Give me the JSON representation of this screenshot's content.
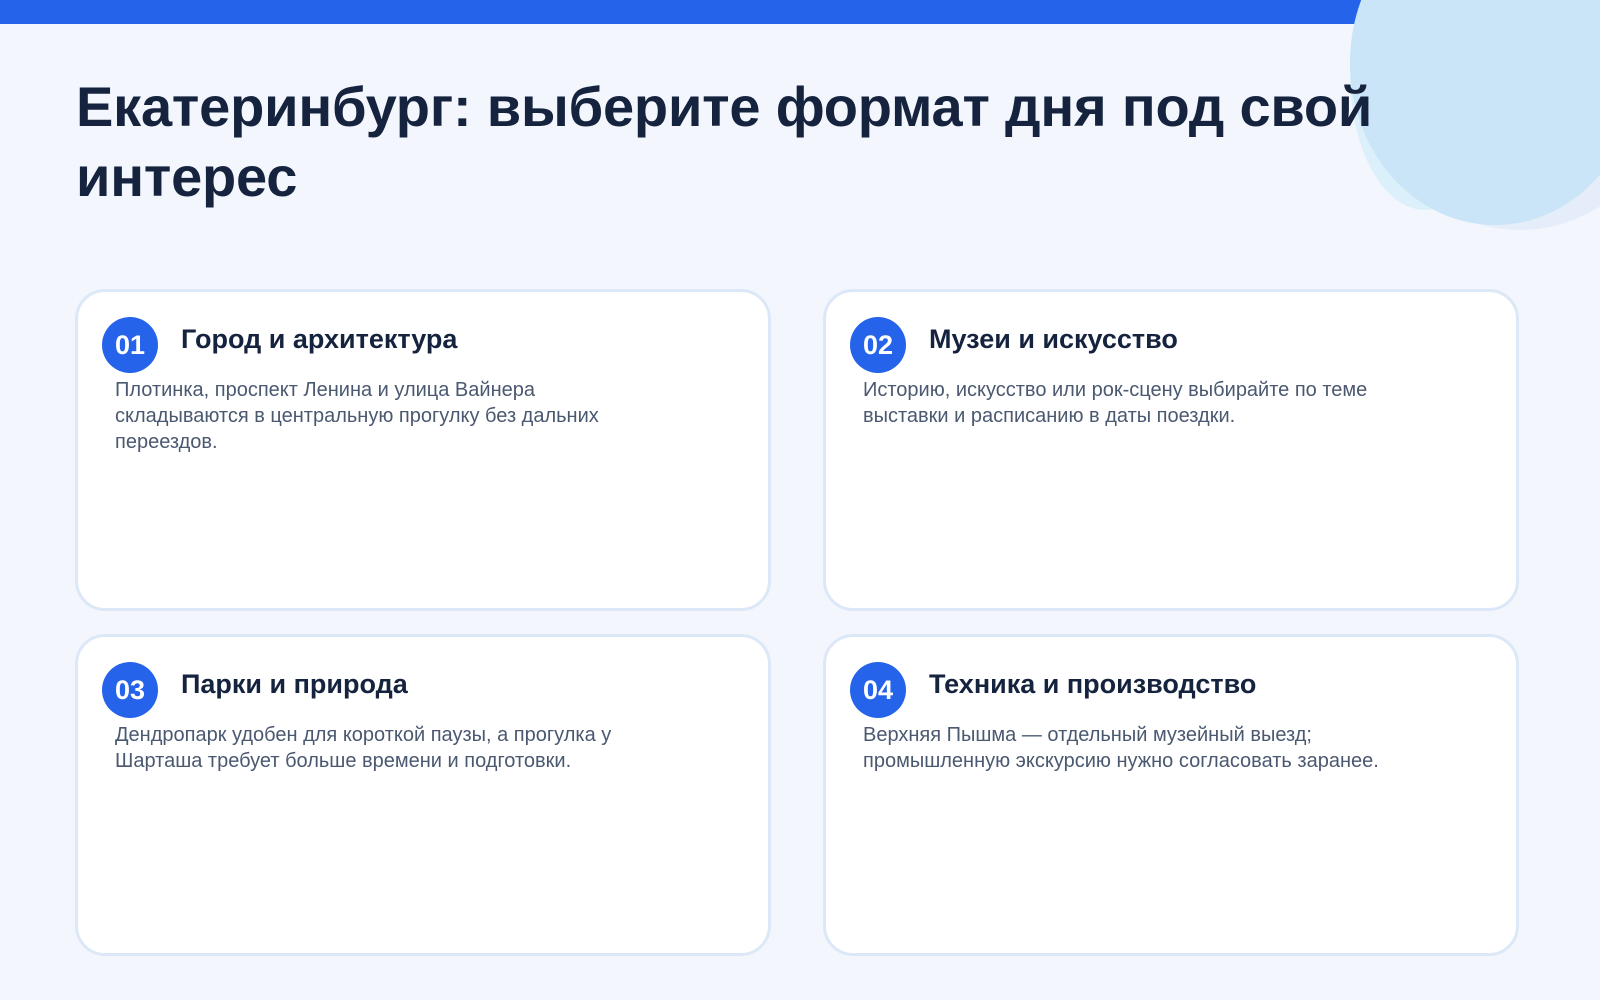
{
  "page": {
    "title": "Екатеринбург: выберите формат дня под свой интерес"
  },
  "colors": {
    "accent": "#2563eb",
    "title": "#15233e",
    "body_text": "#4a5870",
    "card_border": "#dce8f7",
    "background": "#f3f7fd"
  },
  "cards": [
    {
      "number": "01",
      "title": "Город и архитектура",
      "text": "Плотинка, проспект Ленина и улица Вайнера складываются в центральную прогулку без дальних переездов."
    },
    {
      "number": "02",
      "title": "Музеи и искусство",
      "text": "Историю, искусство или рок-сцену выбирайте по теме выставки и расписанию в даты поездки."
    },
    {
      "number": "03",
      "title": "Парки и природа",
      "text": "Дендропарк удобен для короткой паузы, а прогулка у Шарташа требует больше времени и подготовки."
    },
    {
      "number": "04",
      "title": "Техника и производство",
      "text": "Верхняя Пышма — отдельный музейный выезд; промышленную экскурсию нужно согласовать заранее."
    }
  ]
}
